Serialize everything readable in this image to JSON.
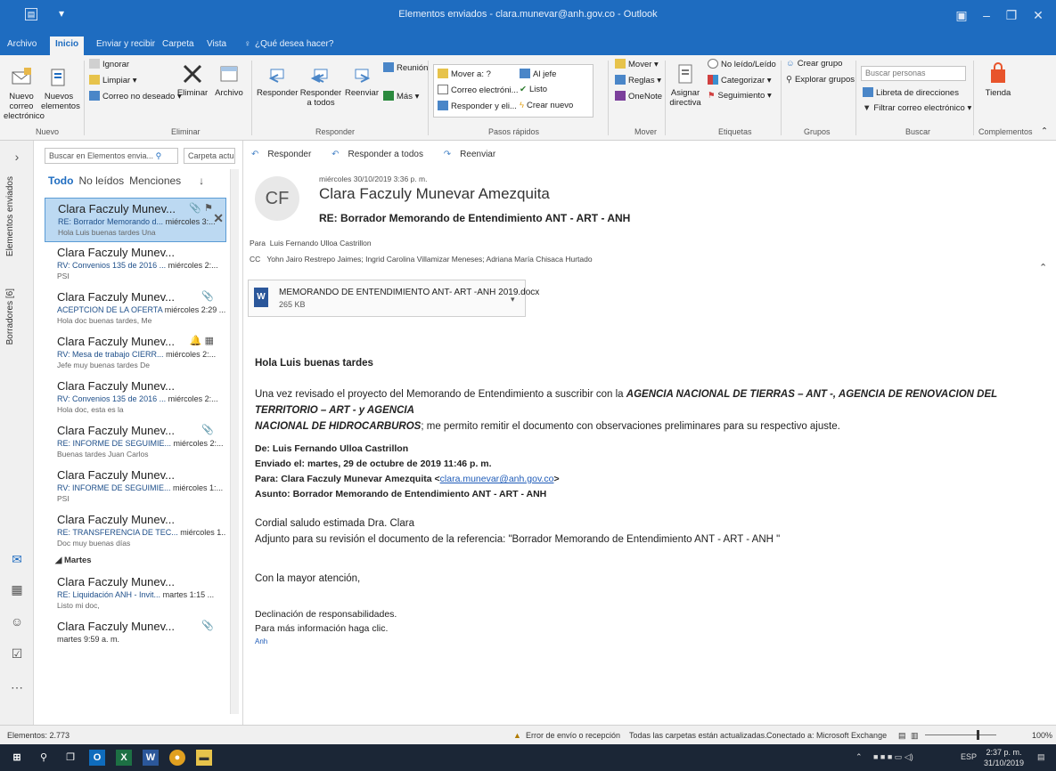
{
  "window": {
    "title": "Elementos enviados - clara.munevar@anh.gov.co - Outlook"
  },
  "tabs": [
    "Archivo",
    "Inicio",
    "Enviar y recibir",
    "Carpeta",
    "Vista"
  ],
  "tell_me": "¿Qué desea hacer?",
  "ribbon": {
    "nuevo": {
      "new_email": "Nuevo correo electrónico",
      "new_items": "Nuevos elementos",
      "label": "Nuevo"
    },
    "eliminar": {
      "ignore": "Ignorar",
      "clean": "Limpiar",
      "junk": "Correo no deseado",
      "delete": "Eliminar",
      "archive": "Archivo",
      "label": "Eliminar"
    },
    "responder": {
      "reply": "Responder",
      "reply_all": "Responder a todos",
      "forward": "Reenviar",
      "meeting": "Reunión",
      "more": "Más",
      "label": "Responder"
    },
    "quick_steps": {
      "move_to": "Mover a: ?",
      "to_boss": "Al jefe",
      "email": "Correo electróni...",
      "done": "Listo",
      "reply_del": "Responder y eli...",
      "create_new": "Crear nuevo",
      "label": "Pasos rápidos"
    },
    "mover": {
      "move": "Mover",
      "rules": "Reglas",
      "onenote": "OneNote",
      "label": "Mover"
    },
    "etiquetas": {
      "assign_policy": "Asignar directiva",
      "unread_read": "No leído/Leído",
      "categorize": "Categorizar",
      "followup": "Seguimiento",
      "label": "Etiquetas"
    },
    "grupos": {
      "create_group": "Crear grupo",
      "browse_groups": "Explorar grupos",
      "label": "Grupos"
    },
    "buscar": {
      "search_people": "Buscar personas",
      "address_book": "Libreta de direcciones",
      "filter_email": "Filtrar correo electrónico",
      "label": "Buscar"
    },
    "complementos": {
      "store": "Tienda",
      "label": "Complementos"
    }
  },
  "rail": {
    "sent": "Elementos enviados",
    "drafts": "Borradores [6]"
  },
  "list": {
    "search_placeholder": "Buscar en Elementos envia...",
    "scope": "Carpeta actual",
    "filter_all": "Todo",
    "filter_unread": "No leídos",
    "filter_mentions": "Menciones",
    "group_tuesday": "Martes",
    "messages": [
      {
        "from": "Clara Faczuly Munev...",
        "subject": "RE: Borrador Memorando d...",
        "time": "miércoles 3:...",
        "preview": "Hola Luis buenas tardes  Una"
      },
      {
        "from": "Clara Faczuly Munev...",
        "subject": "RV: Convenios 135 de 2016 ...",
        "time": "miércoles 2:...",
        "preview": "PSI"
      },
      {
        "from": "Clara Faczuly Munev...",
        "subject": "ACEPTCION DE LA OFERTA",
        "time": "miércoles 2:29 ...",
        "preview": "Hola doc buenas tardes,  Me"
      },
      {
        "from": "Clara Faczuly Munev...",
        "subject": "RV: Mesa de trabajo CIERR...",
        "time": "miércoles 2:...",
        "preview": "Jefe muy buenas tardes  De"
      },
      {
        "from": "Clara Faczuly Munev...",
        "subject": "RV: Convenios 135 de 2016 ...",
        "time": "miércoles 2:...",
        "preview": "Hola doc, esta es la"
      },
      {
        "from": "Clara Faczuly Munev...",
        "subject": "RE: INFORME DE SEGUIMIE...",
        "time": "miércoles 2:...",
        "preview": "Buenas tardes Juan Carlos"
      },
      {
        "from": "Clara Faczuly Munev...",
        "subject": "RV: INFORME DE SEGUIMIE...",
        "time": "miércoles 1:...",
        "preview": "PSI"
      },
      {
        "from": "Clara Faczuly Munev...",
        "subject": "RE: TRANSFERENCIA DE TEC...",
        "time": "miércoles 1...",
        "preview": "Doc muy buenas días"
      },
      {
        "from": "Clara Faczuly Munev...",
        "subject": "RE: Liquidación ANH - Invit...",
        "time": "martes 1:15 ...",
        "preview": "Listo mi doc,"
      },
      {
        "from": "Clara Faczuly Munev...",
        "subject": "",
        "time": "martes 9:59 a. m.",
        "preview": ""
      }
    ]
  },
  "reading": {
    "actions": {
      "reply": "Responder",
      "reply_all": "Responder a todos",
      "forward": "Reenviar"
    },
    "avatar_initials": "CF",
    "date": "miércoles 30/10/2019 3:36 p. m.",
    "sender": "Clara Faczuly Munevar Amezquita",
    "subject": "RE: Borrador Memorando de Entendimiento ANT - ART - ANH",
    "to_label": "Para",
    "to": "Luis Fernando Ulloa Castrillon",
    "cc_label": "CC",
    "cc": "Yohn Jairo Restrepo Jaimes; Ingrid Carolina Villamizar Meneses; Adriana María Chisaca Hurtado",
    "attachment": {
      "name": "MEMORANDO DE ENTENDIMIENTO ANT- ART -ANH 2019.docx",
      "size": "265 KB"
    },
    "greeting": "Hola Luis buenas tardes",
    "para1_a": "Una vez revisado el proyecto del Memorando de Entendimiento  a suscribir con la ",
    "para1_entities_1": "AGENCIA NACIONAL DE TIERRAS – ANT -,  AGENCIA DE RENOVACION DEL TERRITORIO – ART - y AGENCIA",
    "para1_entities_2": "NACIONAL DE HIDROCARBUROS",
    "para1_b": "; me permito remitir el documento con observaciones preliminares para su respectivo ajuste.",
    "fw_from_label": "De:",
    "fw_from": "Luis Fernando Ulloa Castrillon",
    "fw_sent_label": "Enviado el:",
    "fw_sent": "martes, 29 de octubre de 2019 11:46 p. m.",
    "fw_to_label": "Para:",
    "fw_to": "Clara Faczuly Munevar Amezquita <",
    "fw_to_link": "clara.munevar@anh.gov.co",
    "fw_to_end": ">",
    "fw_subject_label": "Asunto:",
    "fw_subject": "Borrador Memorando de Entendimiento ANT - ART - ANH",
    "salute": "Cordial saludo estimada Dra. Clara",
    "attach_note": "Adjunto para su revisión el documento de la referencia: \"Borrador Memorando de Entendimiento ANT - ART - ANH \"",
    "closing": "Con la mayor atención,",
    "disclaimer": "Declinación de responsabilidades.",
    "more_info": "Para más información haga clic.",
    "anh_link": "Anh"
  },
  "status": {
    "items": "Elementos: 2.773",
    "send_error": "Error de envío o recepción",
    "folders": "Todas las carpetas están actualizadas.",
    "connected": "Conectado a: Microsoft Exchange",
    "zoom": "100%"
  },
  "taskbar": {
    "lang": "ESP",
    "time": "2:37 p. m.",
    "date": "31/10/2019"
  },
  "colors": {
    "accent": "#1e6cc0",
    "selection": "#bcd9f2",
    "link": "#1e5bb8"
  }
}
